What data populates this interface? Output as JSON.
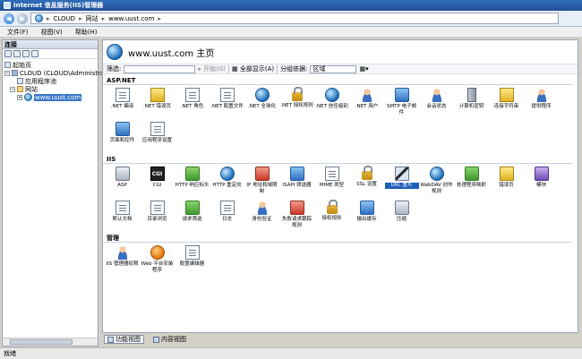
{
  "window": {
    "title": "Internet 信息服务(IIS)管理器"
  },
  "address": {
    "crumbs": [
      "CLOUD",
      "网站",
      "www.uust.com"
    ]
  },
  "menu": [
    "文件(F)",
    "视图(V)",
    "帮助(H)"
  ],
  "left_pane": {
    "title": "连接",
    "tree": [
      {
        "label": "起始页",
        "level": 0
      },
      {
        "label": "CLOUD (CLOUD\\Administrator",
        "level": 0
      },
      {
        "label": "应用程序池",
        "level": 1
      },
      {
        "label": "网站",
        "level": 1
      },
      {
        "label": "www.uust.com",
        "level": 2,
        "selected": true
      }
    ]
  },
  "main": {
    "title": "www.uust.com 主页",
    "filter": {
      "label": "筛选:",
      "go": "开始(G)",
      "show_all": "全部显示(A)",
      "group_by": "分组依据:",
      "group_value": "区域"
    },
    "groups": [
      {
        "name": "ASP.NET",
        "items": [
          {
            "label": ".NET 编译",
            "icon": "doc"
          },
          {
            "label": ".NET 错误页",
            "icon": "yellow"
          },
          {
            "label": ".NET 角色",
            "icon": "doc"
          },
          {
            "label": ".NET 配置文件",
            "icon": "doc"
          },
          {
            "label": ".NET 全球化",
            "icon": "globe"
          },
          {
            "label": ".NET 授权规则",
            "icon": "lock"
          },
          {
            "label": ".NET 信任级别",
            "icon": "globe"
          },
          {
            "label": ".NET 用户",
            "icon": "person"
          },
          {
            "label": "SMTP 电子邮件",
            "icon": "blue"
          },
          {
            "label": "会话状态",
            "icon": "person"
          },
          {
            "label": "计算机密钥",
            "icon": "server"
          },
          {
            "label": "连接字符串",
            "icon": "yellow"
          },
          {
            "label": "提供程序",
            "icon": "person"
          },
          {
            "label": "页面和控件",
            "icon": "blue"
          },
          {
            "label": "应用程序设置",
            "icon": "doc"
          }
        ]
      },
      {
        "name": "IIS",
        "items": [
          {
            "label": "ASP",
            "icon": "gray"
          },
          {
            "label": "CGI",
            "icon": "black"
          },
          {
            "label": "HTTP 响应标头",
            "icon": "green"
          },
          {
            "label": "HTTP 重定向",
            "icon": "globe"
          },
          {
            "label": "IP 地址和域限制",
            "icon": "red"
          },
          {
            "label": "ISAPI 筛选器",
            "icon": "blue"
          },
          {
            "label": "MIME 类型",
            "icon": "doc"
          },
          {
            "label": "SSL 设置",
            "icon": "lock"
          },
          {
            "label": "URL 重写",
            "icon": "pen",
            "selected": true
          },
          {
            "label": "WebDAV 创作规则",
            "icon": "globe"
          },
          {
            "label": "处理程序映射",
            "icon": "green"
          },
          {
            "label": "错误页",
            "icon": "yellow"
          },
          {
            "label": "模块",
            "icon": "purple"
          },
          {
            "label": "默认文档",
            "icon": "doc"
          },
          {
            "label": "目录浏览",
            "icon": "doc"
          },
          {
            "label": "请求筛选",
            "icon": "green"
          },
          {
            "label": "日志",
            "icon": "doc"
          },
          {
            "label": "身份验证",
            "icon": "person"
          },
          {
            "label": "失败请求跟踪规则",
            "icon": "red"
          },
          {
            "label": "授权规则",
            "icon": "lock"
          },
          {
            "label": "输出缓存",
            "icon": "blue"
          },
          {
            "label": "压缩",
            "icon": "gray"
          }
        ]
      },
      {
        "name": "管理",
        "items": [
          {
            "label": "IIS 管理器权限",
            "icon": "person"
          },
          {
            "label": "Web 平台安装程序",
            "icon": "orange"
          },
          {
            "label": "配置编辑器",
            "icon": "doc"
          }
        ]
      }
    ]
  },
  "bottom_tabs": [
    {
      "label": "功能视图",
      "active": true
    },
    {
      "label": "内容视图",
      "active": false
    }
  ],
  "status": "就绪"
}
